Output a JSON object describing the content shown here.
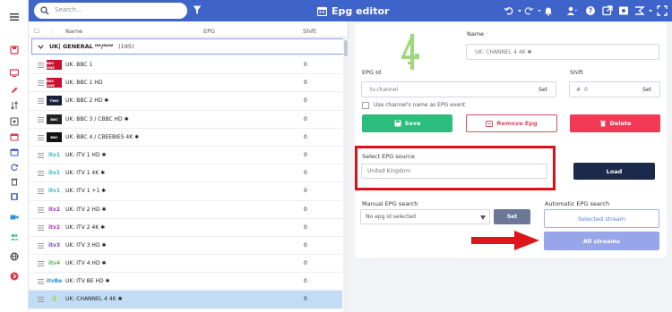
{
  "topbar": {
    "search_placeholder": "Search...",
    "title": "Epg editor"
  },
  "sidebar": {
    "icons": [
      "menu-icon",
      "tv-icon",
      "monitor-icon",
      "edit-icon",
      "sort-icon",
      "settings-icon",
      "calendar-icon",
      "refresh-icon",
      "trash-icon",
      "film-icon",
      "video-icon",
      "users-icon",
      "globe-icon",
      "exit-icon"
    ]
  },
  "list": {
    "columns": {
      "name": "Name",
      "epg": "EPG",
      "shift": "Shift"
    },
    "group": {
      "name": "UK| GENERAL ᴴᴰ/ᴿᴬᵂ",
      "count": "(195)"
    },
    "rows": [
      {
        "name": "UK: BBC 1",
        "logo": "BBC ONE",
        "logo_color": "#c8102e",
        "shift": "0"
      },
      {
        "name": "UK: BBC 1 HD",
        "logo": "BBC ONE",
        "logo_color": "#c8102e",
        "shift": "0"
      },
      {
        "name": "UK: BBC 2 HD ✱",
        "logo": "TWO",
        "logo_color": "#1b1f3b",
        "shift": "0"
      },
      {
        "name": "UK: BBC 3 / CBBC HD ✱",
        "logo": "BBC",
        "logo_color": "#222222",
        "shift": "0"
      },
      {
        "name": "UK: BBC 4 / CBEEBIES 4K ✱",
        "logo": "BBC",
        "logo_color": "#111111",
        "shift": "0"
      },
      {
        "name": "UK: ITV 1 HD ✱",
        "logo": "itv1",
        "logo_color": "#3bb3c3",
        "shift": "0"
      },
      {
        "name": "UK: ITV 1 4K ✱",
        "logo": "itv1",
        "logo_color": "#3bb3c3",
        "shift": "0"
      },
      {
        "name": "UK: ITV 1 +1 ✱",
        "logo": "itv1",
        "logo_color": "#3bb3c3",
        "shift": "0"
      },
      {
        "name": "UK: ITV 2 HD ✱",
        "logo": "itv2",
        "logo_color": "#a23dbf",
        "shift": "0"
      },
      {
        "name": "UK: ITV 2 4K ✱",
        "logo": "itv2",
        "logo_color": "#a23dbf",
        "shift": "0"
      },
      {
        "name": "UK: ITV 3 HD ✱",
        "logo": "itv3",
        "logo_color": "#7a49c5",
        "shift": "0"
      },
      {
        "name": "UK: ITV 4 HD ✱",
        "logo": "itv4",
        "logo_color": "#57b85a",
        "shift": "0"
      },
      {
        "name": "UK: ITV BE HD ✱",
        "logo": "itvBe",
        "logo_color": "#2b8fd1",
        "shift": "0"
      },
      {
        "name": "UK: CHANNEL 4 4K ✱",
        "logo": "4",
        "logo_color": "#9dd97a",
        "shift": "0"
      }
    ]
  },
  "editor": {
    "name_label": "Name",
    "name_value": "UK: CHANNEL 4 4K ✱",
    "epg_id_label": "EPG Id",
    "epg_id_placeholder": "tv.channel",
    "set_label": "Set",
    "shift_label": "Shift",
    "shift_placeholder": "0",
    "shift_prefix": "#",
    "checkbox_label": "Use channel's name as EPG event",
    "save_label": "Save",
    "remove_label": "Remove Epg",
    "delete_label": "Delete",
    "epg_source_label": "Select EPG source",
    "epg_source_value": "United Kingdom",
    "load_label": "Load",
    "manual_search_label": "Manual EPG search",
    "manual_search_value": "No epg id selected",
    "auto_search_label": "Automatic EPG search",
    "selected_stream_label": "Selected stream",
    "all_streams_label": "All streams"
  },
  "colors": {
    "topbar": "#3e63c9",
    "save": "#2bbd7e",
    "delete": "#f23a56",
    "highlight": "#d8121b",
    "channel4_logo": "#9dd97a"
  }
}
